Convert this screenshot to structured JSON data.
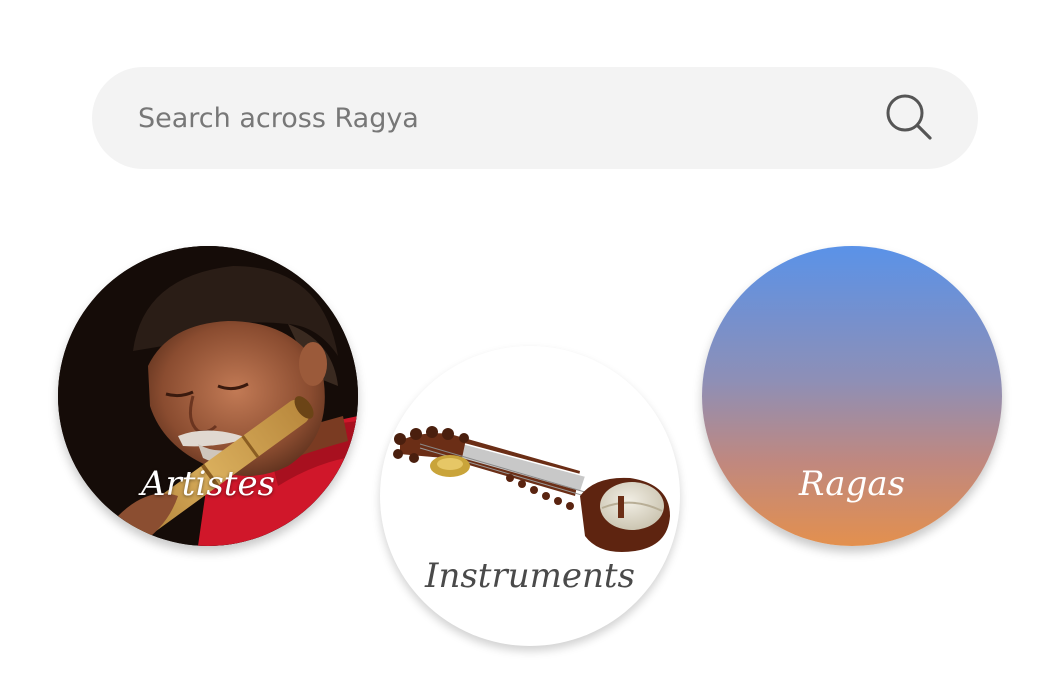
{
  "search": {
    "placeholder": "Search across Ragya",
    "icon": "search-icon"
  },
  "categories": [
    {
      "label": "Artistes",
      "image": "flute-player-photo"
    },
    {
      "label": "Instruments",
      "image": "sarod-instrument-photo"
    },
    {
      "label": "Ragas",
      "image": "gradient",
      "colors": [
        "#5a92e8",
        "#e3904e"
      ]
    }
  ],
  "colors": {
    "search_background": "#f3f3f3",
    "placeholder_text": "#777777",
    "instrument_label": "#4a4a4a"
  }
}
